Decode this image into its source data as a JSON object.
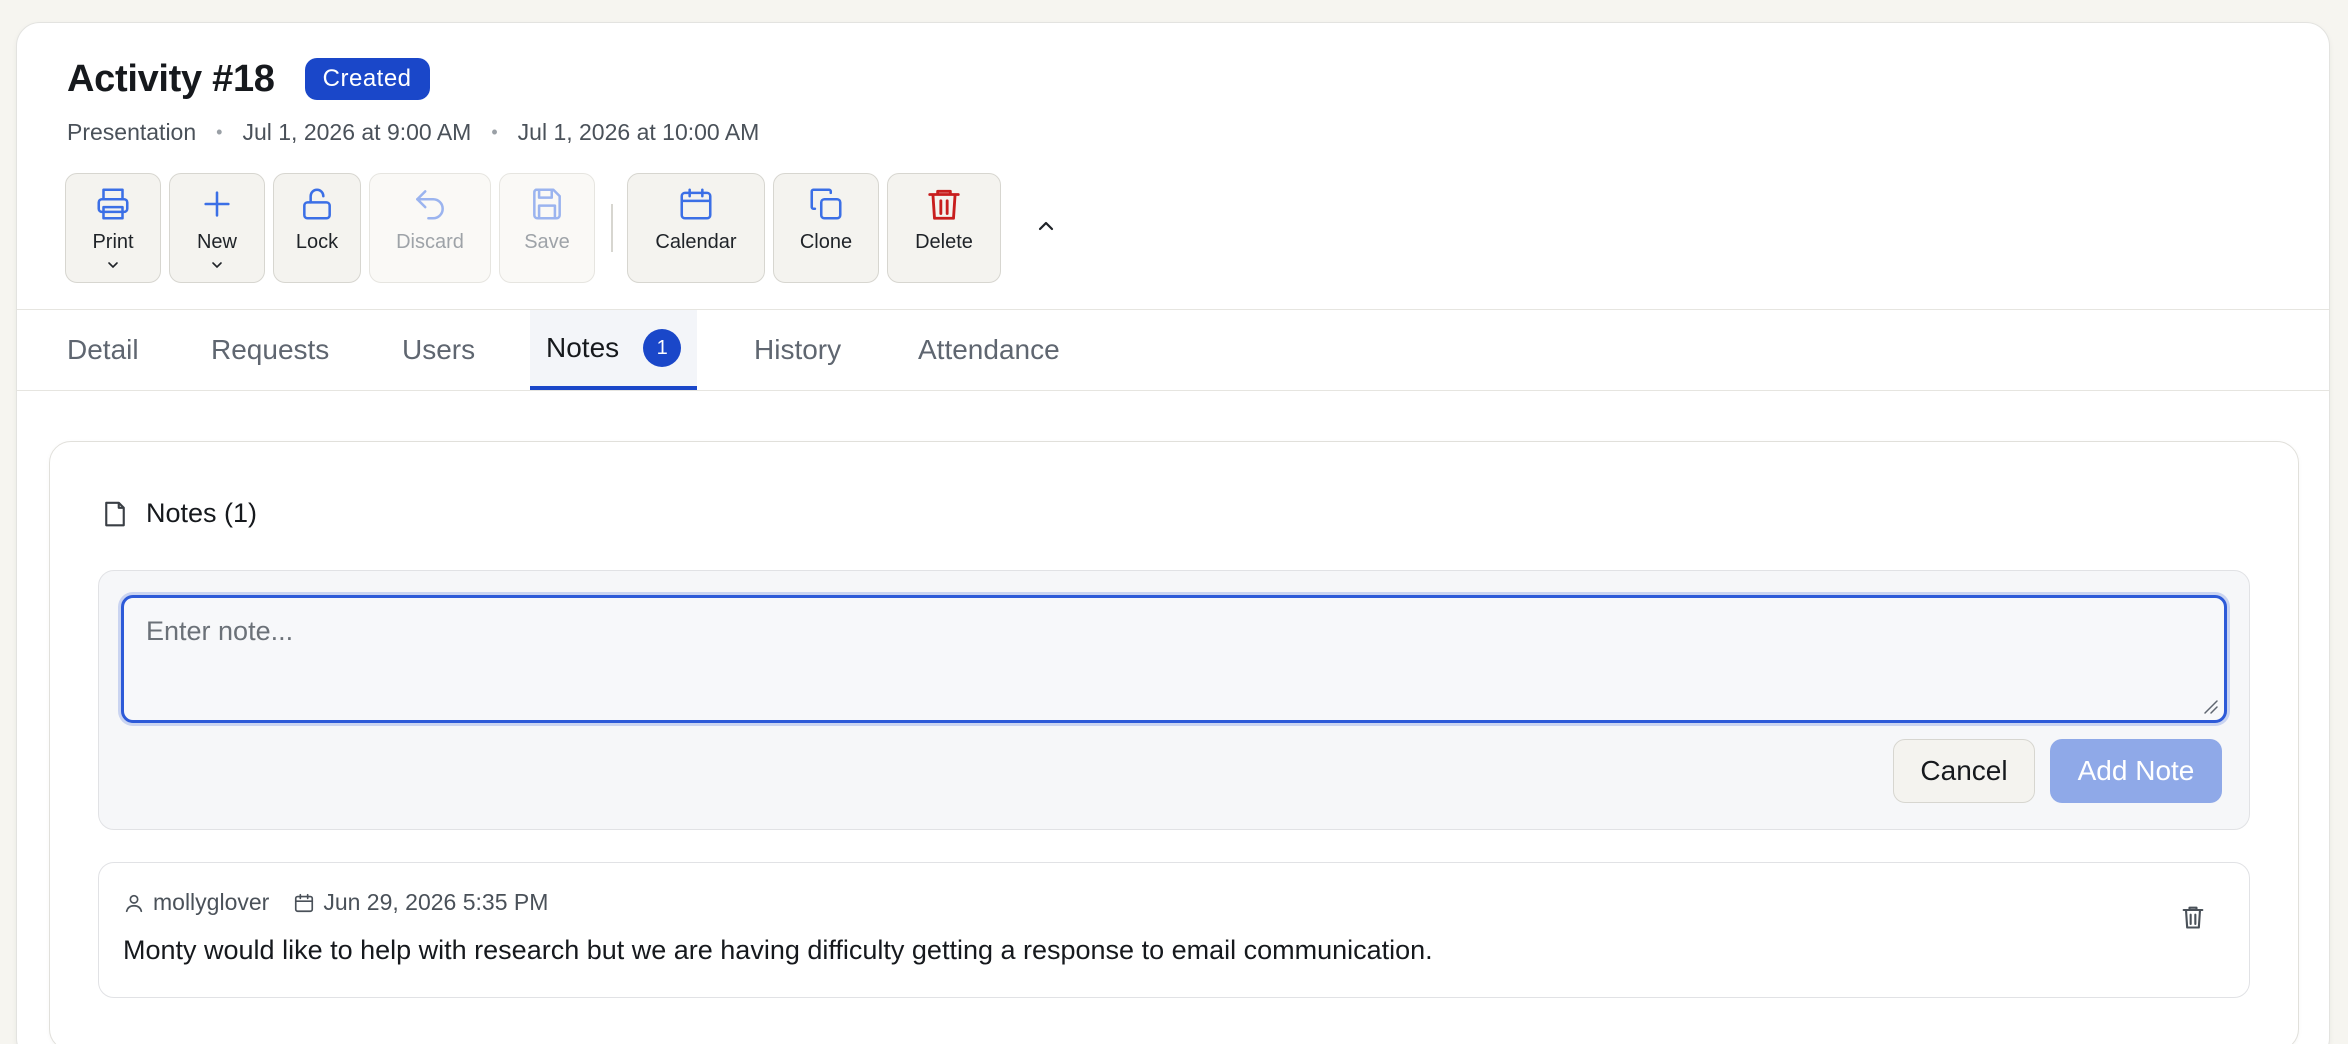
{
  "header": {
    "title": "Activity #18",
    "status": "Created",
    "meta": {
      "type": "Presentation",
      "start": "Jul 1, 2026 at 9:00 AM",
      "end": "Jul 1, 2026 at 10:00 AM",
      "separator": "•"
    }
  },
  "toolbar": {
    "print": "Print",
    "new": "New",
    "lock": "Lock",
    "discard": "Discard",
    "save": "Save",
    "calendar": "Calendar",
    "clone": "Clone",
    "delete": "Delete"
  },
  "tabs": {
    "detail": "Detail",
    "requests": "Requests",
    "users": "Users",
    "notes": "Notes",
    "notes_count": "1",
    "history": "History",
    "attendance": "Attendance"
  },
  "notes_panel": {
    "title": "Notes (1)",
    "input_value": "",
    "input_placeholder": "Enter note...",
    "cancel_label": "Cancel",
    "add_label": "Add Note",
    "items": [
      {
        "author": "mollyglover",
        "date": "Jun 29, 2026 5:35 PM",
        "text": "Monty would like to help with research but we are having difficulty getting a response to email communication."
      }
    ]
  },
  "icons": {
    "print": "printer-icon",
    "new": "plus-icon",
    "lock": "unlock-icon",
    "discard": "undo-icon",
    "save": "floppy-icon",
    "calendar": "calendar-icon",
    "clone": "copy-icon",
    "delete": "trash-icon",
    "collapse": "chevron-up-icon",
    "notes": "file-icon",
    "author": "user-icon",
    "date": "calendar-icon"
  },
  "colors": {
    "accent": "#1a47c9",
    "danger": "#c81e1e",
    "icon_blue": "#3b6fe6",
    "disabled_blue": "#9bb4ef"
  }
}
